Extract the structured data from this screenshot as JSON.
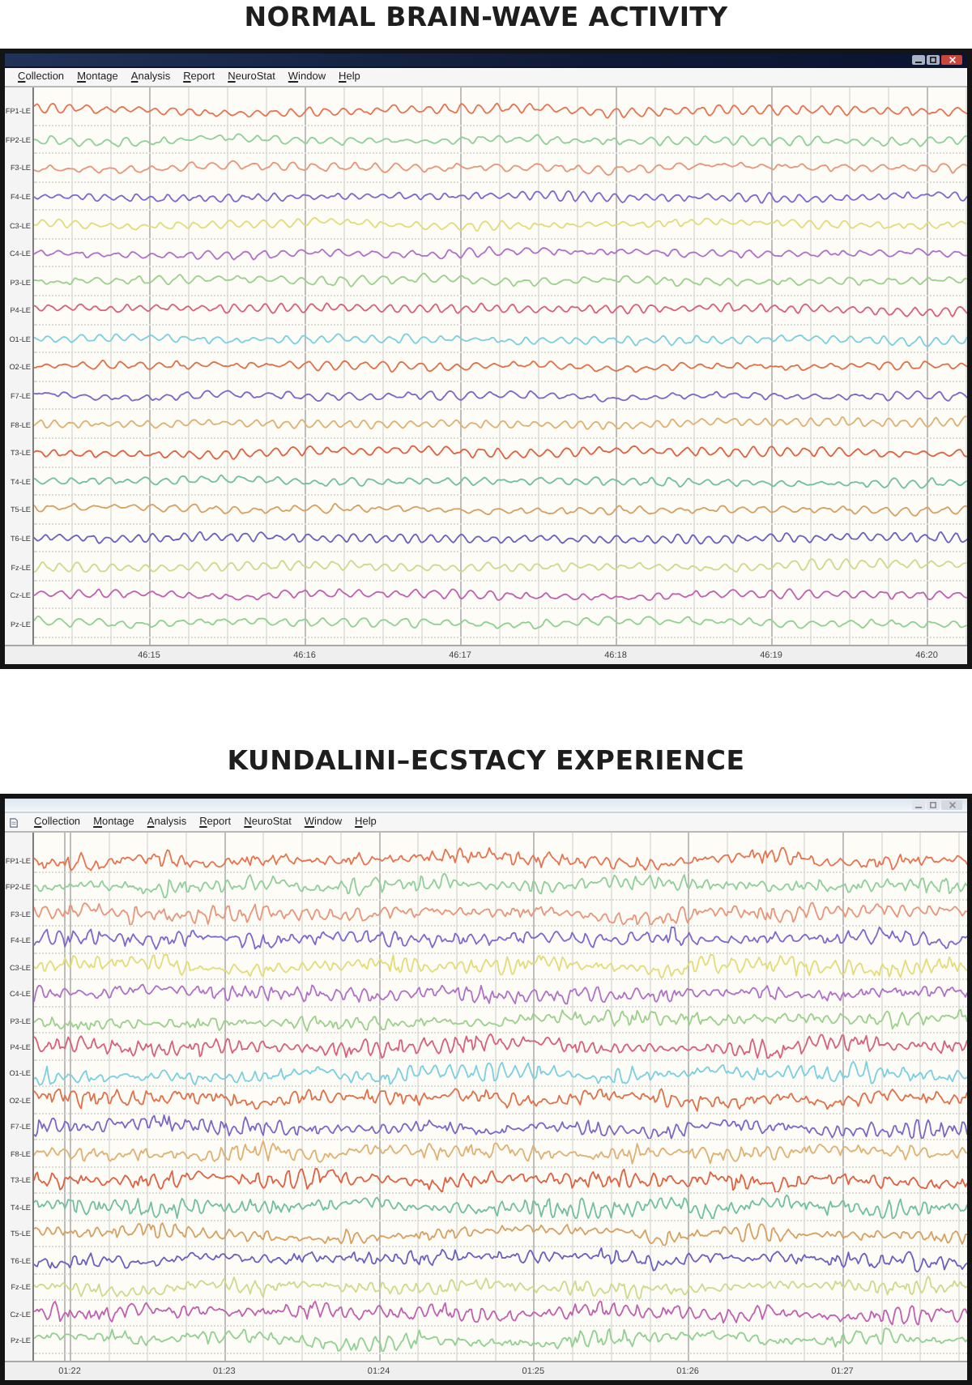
{
  "panels": [
    {
      "heading": "NORMAL BRAIN-WAVE ACTIVITY",
      "kind": "calm",
      "active": true,
      "system_menu": false,
      "menu": [
        "Collection",
        "Montage",
        "Analysis",
        "Report",
        "NeuroStat",
        "Window",
        "Help"
      ],
      "channels": [
        {
          "label": "FP1-LE",
          "color": "#e8734f"
        },
        {
          "label": "FP2-LE",
          "color": "#8fcf9a"
        },
        {
          "label": "F3-LE",
          "color": "#e8957a"
        },
        {
          "label": "F4-LE",
          "color": "#7a6ad0"
        },
        {
          "label": "C3-LE",
          "color": "#e2dc78"
        },
        {
          "label": "C4-LE",
          "color": "#b070c8"
        },
        {
          "label": "P3-LE",
          "color": "#9ad08a"
        },
        {
          "label": "P4-LE",
          "color": "#d8607a"
        },
        {
          "label": "O1-LE",
          "color": "#7acfe0"
        },
        {
          "label": "O2-LE",
          "color": "#e07048"
        },
        {
          "label": "F7-LE",
          "color": "#7868c8"
        },
        {
          "label": "F8-LE",
          "color": "#e0b070"
        },
        {
          "label": "T3-LE",
          "color": "#e06040"
        },
        {
          "label": "T4-LE",
          "color": "#70c0a0"
        },
        {
          "label": "T5-LE",
          "color": "#d8a060"
        },
        {
          "label": "T6-LE",
          "color": "#6a60c0"
        },
        {
          "label": "Fz-LE",
          "color": "#d0d88a"
        },
        {
          "label": "Cz-LE",
          "color": "#c060b0"
        },
        {
          "label": "Pz-LE",
          "color": "#90d090"
        }
      ],
      "time_ticks": [
        "46:15",
        "46:16",
        "46:17",
        "46:18",
        "46:19",
        "46:20"
      ]
    },
    {
      "heading": "KUNDALINI–ECSTACY EXPERIENCE",
      "kind": "burst",
      "active": false,
      "system_menu": true,
      "menu": [
        "Collection",
        "Montage",
        "Analysis",
        "Report",
        "NeuroStat",
        "Window",
        "Help"
      ],
      "channels": [
        {
          "label": "FP1-LE",
          "color": "#e8734f"
        },
        {
          "label": "FP2-LE",
          "color": "#8fcf9a"
        },
        {
          "label": "F3-LE",
          "color": "#e8957a"
        },
        {
          "label": "F4-LE",
          "color": "#7a6ad0"
        },
        {
          "label": "C3-LE",
          "color": "#e2dc78"
        },
        {
          "label": "C4-LE",
          "color": "#b070c8"
        },
        {
          "label": "P3-LE",
          "color": "#9ad08a"
        },
        {
          "label": "P4-LE",
          "color": "#d8607a"
        },
        {
          "label": "O1-LE",
          "color": "#7acfe0"
        },
        {
          "label": "O2-LE",
          "color": "#e07048"
        },
        {
          "label": "F7-LE",
          "color": "#7868c8"
        },
        {
          "label": "F8-LE",
          "color": "#e0b070"
        },
        {
          "label": "T3-LE",
          "color": "#e06040"
        },
        {
          "label": "T4-LE",
          "color": "#70c0a0"
        },
        {
          "label": "T5-LE",
          "color": "#d8a060"
        },
        {
          "label": "T6-LE",
          "color": "#6a60c0"
        },
        {
          "label": "Fz-LE",
          "color": "#d0d88a"
        },
        {
          "label": "Cz-LE",
          "color": "#c060b0"
        },
        {
          "label": "Pz-LE",
          "color": "#90d090"
        }
      ],
      "time_ticks": [
        "01:22",
        "01:23",
        "01:24",
        "01:25",
        "01:26",
        "01:27"
      ]
    }
  ]
}
